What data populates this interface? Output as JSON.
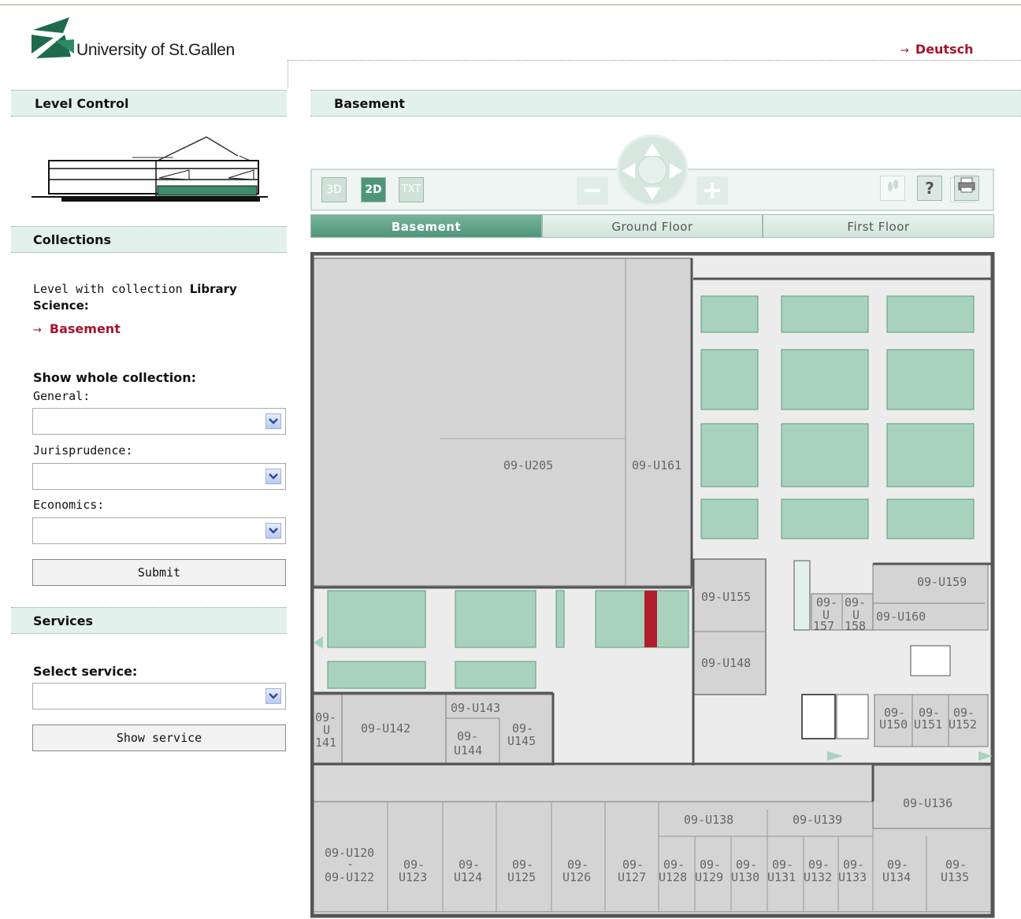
{
  "header": {
    "university_name": "University of St.Gallen",
    "language_link": "Deutsch",
    "arrow_glyph": "→"
  },
  "left": {
    "level_control_title": "Level Control",
    "collections_title": "Collections",
    "collection_intro": "Level with collection ",
    "collection_name_line1": "Library",
    "collection_name_line2": "Science:",
    "collection_level_link": "Basement",
    "show_whole_title": "Show whole collection:",
    "general_label": "General:",
    "jurisprudence_label": "Jurisprudence:",
    "economics_label": "Economics:",
    "submit_label": "Submit",
    "services_title": "Services",
    "select_service_label": "Select service:",
    "show_service_label": "Show service"
  },
  "main": {
    "level_title": "Basement",
    "view_modes": [
      "3D",
      "2D",
      "TXT"
    ],
    "active_view": "2D",
    "tabs": [
      {
        "label": "Basement",
        "active": true
      },
      {
        "label": "Ground Floor",
        "active": false
      },
      {
        "label": "First Floor",
        "active": false
      }
    ]
  },
  "colors": {
    "brand_green": "#1d6a4d",
    "accent_red": "#a7142b",
    "bar_bg": "#e3f1ec",
    "shelf_green": "#a9d2bd",
    "room_grey": "#d4d4d4"
  },
  "rooms": {
    "u205": "09-U205",
    "u161": "09-U161",
    "u155": "09-U155",
    "u148": "09-U148",
    "u159": "09-U159",
    "u160": "09-U160",
    "u157a": "09-",
    "u157b": "U",
    "u157c": "157",
    "u158a": "09-",
    "u158b": "U",
    "u158c": "158",
    "u141a": "09-",
    "u141b": "U",
    "u141c": "141",
    "u142": "09-U142",
    "u143": "09-U143",
    "u144a": "09-",
    "u144b": "U144",
    "u145a": "09-",
    "u145b": "U145",
    "u150a": "09-",
    "u150b": "U150",
    "u151a": "09-",
    "u151b": "U151",
    "u152a": "09-",
    "u152b": "U152",
    "u136": "09-U136",
    "u138": "09-U138",
    "u139": "09-U139",
    "u120": "09-U120",
    "u120dash": "-",
    "u122": "09-U122",
    "u123a": "09-",
    "u123b": "U123",
    "u124a": "09-",
    "u124b": "U124",
    "u125a": "09-",
    "u125b": "U125",
    "u126a": "09-",
    "u126b": "U126",
    "u127a": "09-",
    "u127b": "U127",
    "u128a": "09-",
    "u128b": "U128",
    "u129a": "09-",
    "u129b": "U129",
    "u130a": "09-",
    "u130b": "U130",
    "u131a": "09-",
    "u131b": "U131",
    "u132a": "09-",
    "u132b": "U132",
    "u133a": "09-",
    "u133b": "U133",
    "u134a": "09-",
    "u134b": "U134",
    "u135a": "09-",
    "u135b": "U135"
  }
}
